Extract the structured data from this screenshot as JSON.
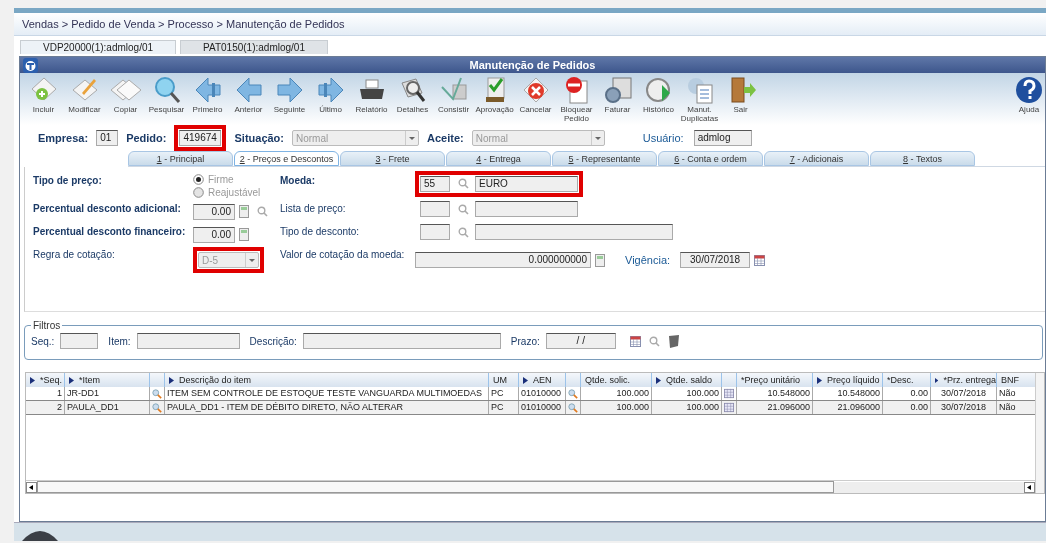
{
  "breadcrumb": "Vendas > Pedido de Venda > Processo > Manutenção de Pedidos",
  "sessions": [
    {
      "label": "VDP20000(1):admlog/01",
      "selected": true
    },
    {
      "label": "PAT0150(1):admlog/01",
      "selected": false
    }
  ],
  "window": {
    "title": "Manutenção de Pedidos"
  },
  "toolbar": [
    {
      "kind": "add",
      "label": "Incluir"
    },
    {
      "kind": "edit",
      "label": "Modificar"
    },
    {
      "kind": "copy",
      "label": "Copiar"
    },
    {
      "kind": "search",
      "label": "Pesquisar"
    },
    {
      "kind": "first",
      "label": "Primeiro"
    },
    {
      "kind": "prev",
      "label": "Anterior"
    },
    {
      "kind": "next",
      "label": "Seguinte"
    },
    {
      "kind": "last",
      "label": "Último"
    },
    {
      "kind": "print",
      "label": "Relatório"
    },
    {
      "kind": "details",
      "label": "Detalhes"
    },
    {
      "kind": "check",
      "label": "Consistir"
    },
    {
      "kind": "approve",
      "label": "Aprovação"
    },
    {
      "kind": "cancel",
      "label": "Cancelar"
    },
    {
      "kind": "block",
      "label": "Bloquear Pedido"
    },
    {
      "kind": "invoice",
      "label": "Faturar"
    },
    {
      "kind": "history",
      "label": "Histórico"
    },
    {
      "kind": "duplicates",
      "label": "Manut. Duplicatas"
    },
    {
      "kind": "exit",
      "label": "Sair"
    }
  ],
  "help": {
    "label": "Ajuda"
  },
  "header": {
    "empresa": {
      "label": "Empresa:",
      "value": "01"
    },
    "pedido": {
      "label": "Pedido:",
      "value": "419674",
      "highlighted": true
    },
    "situacao": {
      "label": "Situação:",
      "value": "Normal"
    },
    "aceite": {
      "label": "Aceite:",
      "value": "Normal"
    },
    "usuario": {
      "label": "Usuário:",
      "value": "admlog"
    }
  },
  "form_tabs": [
    {
      "key": "1",
      "label": " - Principal",
      "selected": false
    },
    {
      "key": "2",
      "label": " - Preços e Descontos",
      "selected": true
    },
    {
      "key": "3",
      "label": " - Frete",
      "selected": false
    },
    {
      "key": "4",
      "label": " - Entrega",
      "selected": false
    },
    {
      "key": "5",
      "label": " - Representante",
      "selected": false
    },
    {
      "key": "6",
      "label": " - Conta e ordem",
      "selected": false
    },
    {
      "key": "7",
      "label": " - Adicionais",
      "selected": false
    },
    {
      "key": "8",
      "label": " - Textos",
      "selected": false
    }
  ],
  "form_rows": [
    {
      "left": {
        "kind": "radio",
        "label": "Tipo de preço:",
        "required": true,
        "options": [
          {
            "label": "Firme",
            "selected": true
          },
          {
            "label": "Reajustável",
            "selected": false
          }
        ]
      },
      "right": {
        "kind": "lookup",
        "label": "Moeda:",
        "required": true,
        "code": "55",
        "description": "EURO",
        "highlighted": true
      }
    },
    {
      "left": {
        "kind": "number",
        "label": "Percentual desconto adicional:",
        "required": true,
        "value": "0.00",
        "lookup": true
      },
      "right": {
        "kind": "lookup",
        "label": "Lista de preço:",
        "required": false,
        "highlighted": false
      }
    },
    {
      "left": {
        "kind": "number",
        "label": "Percentual desconto financeiro:",
        "required": true,
        "value": "0.00",
        "lookup": false
      },
      "right": {
        "kind": "lookup",
        "label": "Tipo de desconto:",
        "required": false,
        "highlighted": false,
        "wide": true
      }
    },
    {
      "left": {
        "kind": "select",
        "label": "Regra de cotação:",
        "required": false,
        "value": "D-5",
        "highlighted": true
      },
      "right": {
        "kind": "rate",
        "label": "Valor de cotação da moeda:",
        "required": false,
        "value": "0.000000000",
        "date_label": "Vigência:",
        "date": "30/07/2018"
      }
    }
  ],
  "filters": {
    "title": "Filtros",
    "seq": "Seq.:",
    "item": "Item:",
    "descricao": "Descrição:",
    "prazo": "Prazo:",
    "prazo_value": "/ /"
  },
  "table": {
    "columns": [
      {
        "label": "*Seq.",
        "kind": "num",
        "sortable": true
      },
      {
        "label": "*Item",
        "kind": "text",
        "sortable": true,
        "lookup": true
      },
      {
        "label": "Descrição do item",
        "kind": "text",
        "sortable": true
      },
      {
        "label": "UM",
        "kind": "text",
        "sortable": false
      },
      {
        "label": "AEN",
        "kind": "text",
        "sortable": true,
        "lookup": true
      },
      {
        "label": "Qtde. solic.",
        "kind": "num",
        "sortable": false
      },
      {
        "label": "Qtde. saldo",
        "kind": "num",
        "sortable": true,
        "grid": true
      },
      {
        "label": "*Preço unitário",
        "kind": "num",
        "sortable": false
      },
      {
        "label": "Preço líquido",
        "kind": "num",
        "sortable": true
      },
      {
        "label": "*Desc.",
        "kind": "num",
        "sortable": false
      },
      {
        "label": "*Prz. entrega",
        "kind": "center",
        "sortable": true
      },
      {
        "label": "BNF",
        "kind": "text",
        "sortable": false
      }
    ],
    "rows": [
      {
        "cells": [
          "1",
          "JR-DD1",
          "ITEM SEM CONTROLE DE ESTOQUE TESTE VANGUARDA MULTIMOEDAS",
          "PC",
          "01010000",
          "100.000",
          "100.000",
          "10.548000",
          "10.548000",
          "0.00",
          "30/07/2018",
          "Não"
        ]
      },
      {
        "cells": [
          "2",
          "PAULA_DD1",
          "PAULA_DD1 - ITEM DE DÉBITO DIRETO, NÃO ALTERAR",
          "PC",
          "01010000",
          "100.000",
          "100.000",
          "21.096000",
          "21.096000",
          "0.00",
          "30/07/2018",
          "Não"
        ]
      }
    ]
  }
}
